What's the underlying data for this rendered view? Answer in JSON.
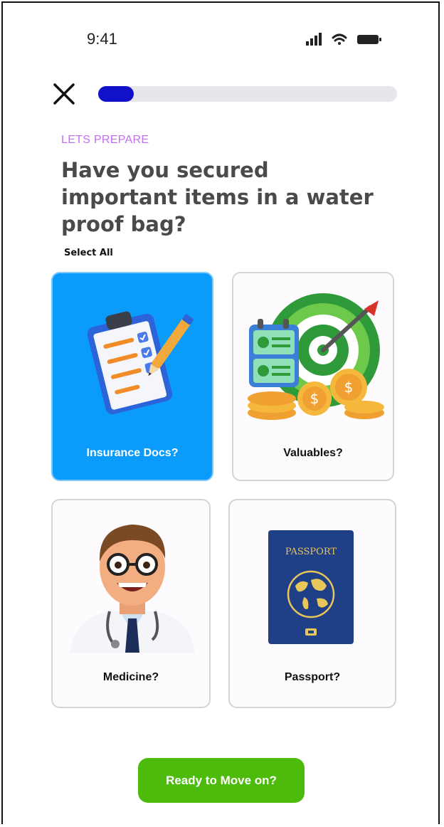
{
  "status_bar": {
    "time": "9:41",
    "icons": [
      "signal-icon",
      "wifi-icon",
      "battery-icon"
    ]
  },
  "header": {
    "close_icon": "close-icon",
    "progress": 0.12,
    "progress_color": "#1111cc"
  },
  "question": {
    "eyebrow": "LETS PREPARE",
    "title": "Have you secured important items in a water proof bag?",
    "select_all": "Select All"
  },
  "options": [
    {
      "label": "Insurance Docs?",
      "icon": "clipboard-checklist-icon",
      "selected": true
    },
    {
      "label": "Valuables?",
      "icon": "target-coins-icon",
      "selected": false
    },
    {
      "label": "Medicine?",
      "icon": "doctor-avatar-icon",
      "selected": false
    },
    {
      "label": "Passport?",
      "icon": "passport-icon",
      "selected": false
    }
  ],
  "cta": {
    "label": "Ready to Move on?",
    "color": "#4cbb0b"
  },
  "colors": {
    "accent": "#c26ef0",
    "selected_card": "#0b9bfb"
  }
}
